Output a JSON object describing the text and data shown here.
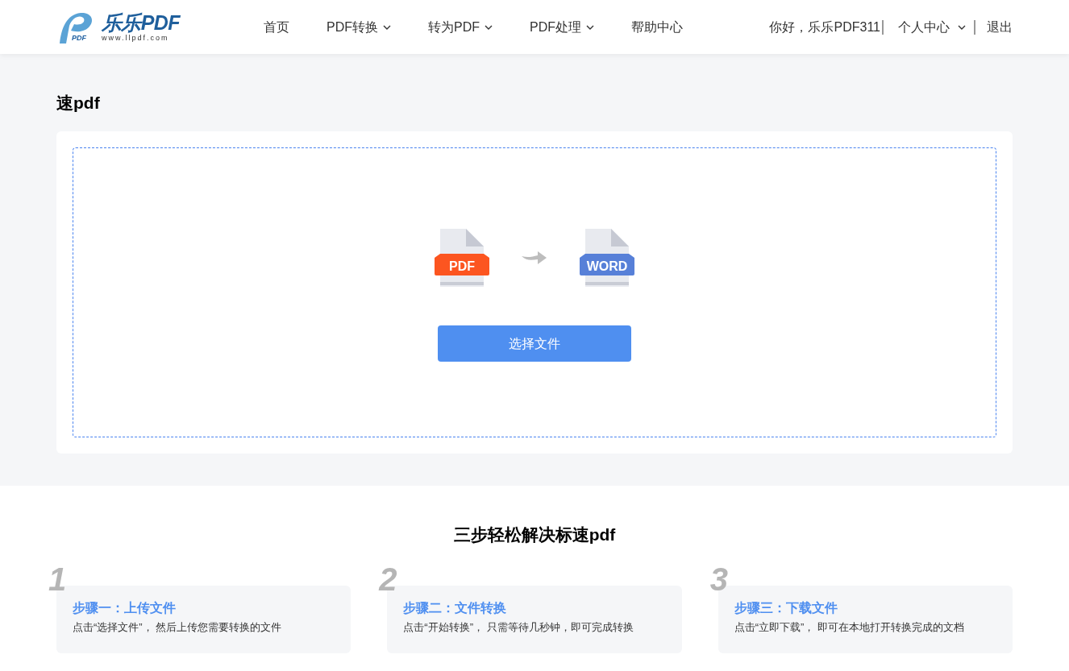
{
  "header": {
    "logo": {
      "mark_text": "PDF",
      "name": "乐乐PDF",
      "url": "www.llpdf.com"
    },
    "nav": [
      {
        "label": "首页",
        "dropdown": false
      },
      {
        "label": "PDF转换",
        "dropdown": true
      },
      {
        "label": "转为PDF",
        "dropdown": true
      },
      {
        "label": "PDF处理",
        "dropdown": true
      },
      {
        "label": "帮助中心",
        "dropdown": false
      }
    ],
    "greeting": "你好，乐乐PDF311",
    "user_menu": "个人中心",
    "logout": "退出"
  },
  "page_title": "速pdf",
  "upload": {
    "from_label": "PDF",
    "to_label": "WORD",
    "button": "选择文件"
  },
  "steps_title": "三步轻松解决标速pdf",
  "steps": [
    {
      "number": "1",
      "title": "步骤一：上传文件",
      "text": "点击“选择文件”， 然后上传您需要转换的文件"
    },
    {
      "number": "2",
      "title": "步骤二：文件转换",
      "text": "点击“开始转换”， 只需等待几秒钟，即可完成转换"
    },
    {
      "number": "3",
      "title": "步骤三：下载文件",
      "text": "点击“立即下载”， 即可在本地打开转换完成的文档"
    }
  ]
}
